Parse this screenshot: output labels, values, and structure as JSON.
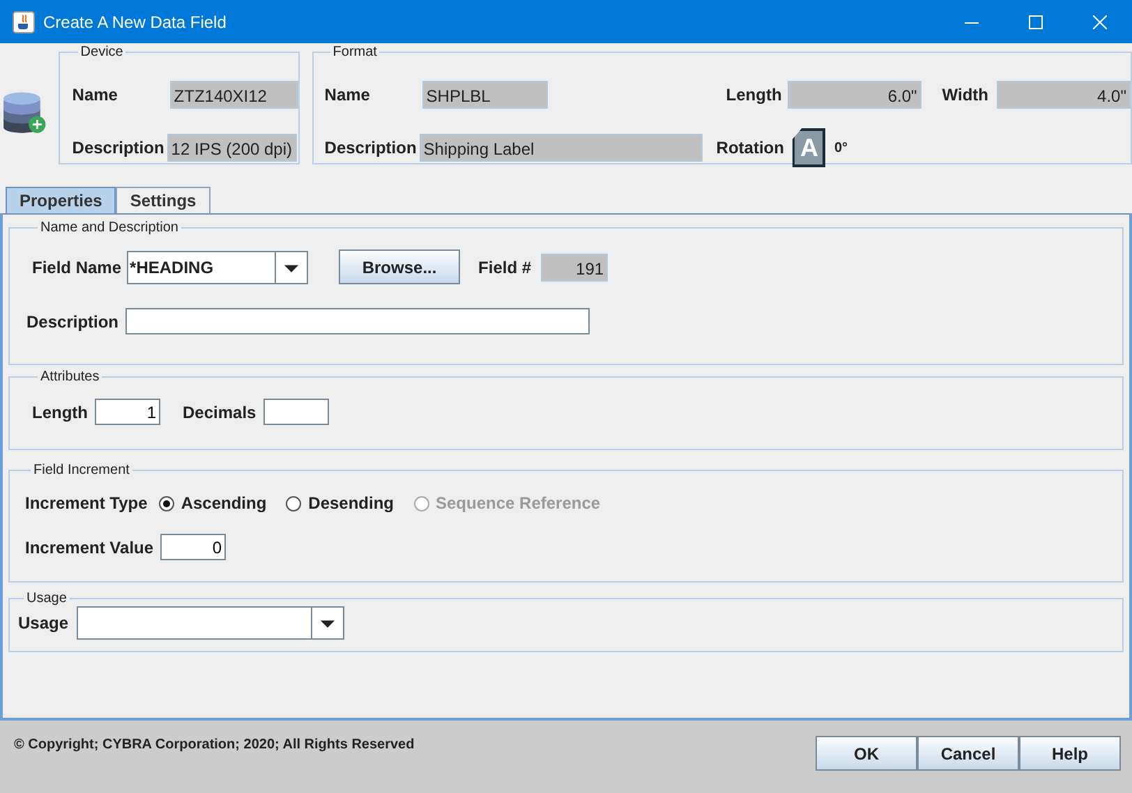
{
  "window": {
    "title": "Create A New Data Field"
  },
  "device": {
    "legend": "Device",
    "fields": [
      {
        "label": "Name",
        "value": "ZTZ140XI12"
      },
      {
        "label": "Description",
        "value": "12 IPS (200 dpi)"
      }
    ]
  },
  "format": {
    "legend": "Format",
    "name": {
      "label": "Name",
      "value": "SHPLBL"
    },
    "description": {
      "label": "Description",
      "value": "Shipping Label"
    },
    "length": {
      "label": "Length",
      "value": "6.0\""
    },
    "width": {
      "label": "Width",
      "value": "4.0\""
    },
    "rotation": {
      "label": "Rotation",
      "icon_text": "A",
      "value": "0°"
    }
  },
  "tabs": [
    {
      "label": "Properties",
      "selected": true
    },
    {
      "label": "Settings",
      "selected": false
    }
  ],
  "name_and_description": {
    "legend": "Name and Description",
    "field_name": {
      "label": "Field Name",
      "value": "*HEADING"
    },
    "browse_button": "Browse...",
    "field_number": {
      "label": "Field #",
      "value": "191"
    },
    "description": {
      "label": "Description"
    }
  },
  "attributes": {
    "legend": "Attributes",
    "length": {
      "label": "Length",
      "value": "1"
    },
    "decimals": {
      "label": "Decimals"
    }
  },
  "field_increment": {
    "legend": "Field Increment",
    "type_label": "Increment Type",
    "options": [
      {
        "label": "Ascending",
        "selected": true,
        "disabled": false
      },
      {
        "label": "Desending",
        "selected": false,
        "disabled": false
      },
      {
        "label": "Sequence Reference",
        "selected": false,
        "disabled": true
      }
    ],
    "increment_value": {
      "label": "Increment Value",
      "value": "0"
    }
  },
  "usage": {
    "legend": "Usage",
    "label": "Usage"
  },
  "footer": {
    "copyright": "© Copyright; CYBRA Corporation; 2020; All Rights Reserved",
    "buttons": [
      "OK",
      "Cancel",
      "Help"
    ]
  }
}
